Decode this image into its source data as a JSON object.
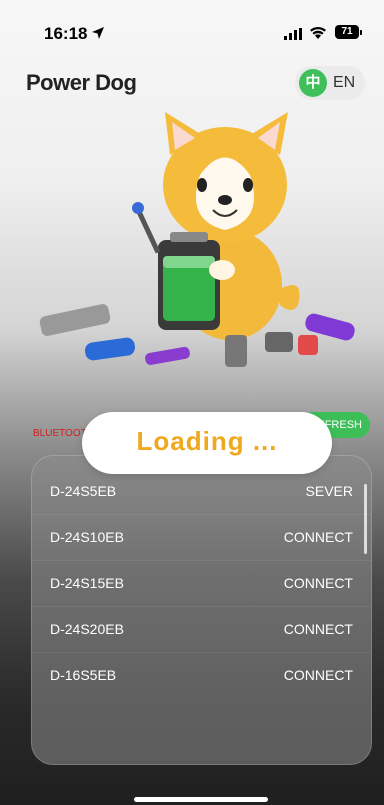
{
  "status_bar": {
    "time": "16:18",
    "battery": "71"
  },
  "header": {
    "app_title": "Power Dog",
    "lang_zh": "中",
    "lang_en": "EN"
  },
  "bluetooth": {
    "label": "BLUETOOT",
    "refresh_label": "EFRESH"
  },
  "loading": {
    "text": "Loading ..."
  },
  "devices": [
    {
      "name": "D-24S5EB",
      "action": "SEVER"
    },
    {
      "name": "D-24S10EB",
      "action": "CONNECT"
    },
    {
      "name": "D-24S15EB",
      "action": "CONNECT"
    },
    {
      "name": "D-24S20EB",
      "action": "CONNECT"
    },
    {
      "name": "D-16S5EB",
      "action": "CONNECT"
    }
  ],
  "colors": {
    "accent_green": "#3fbf5a",
    "loading_orange": "#f0a81e",
    "bluetooth_red": "#cc2222"
  },
  "icons": {
    "location": "location-arrow-icon",
    "signal": "cellular-signal-icon",
    "wifi": "wifi-icon",
    "battery": "battery-icon",
    "mascot": "corgi-mascot-illustration"
  }
}
